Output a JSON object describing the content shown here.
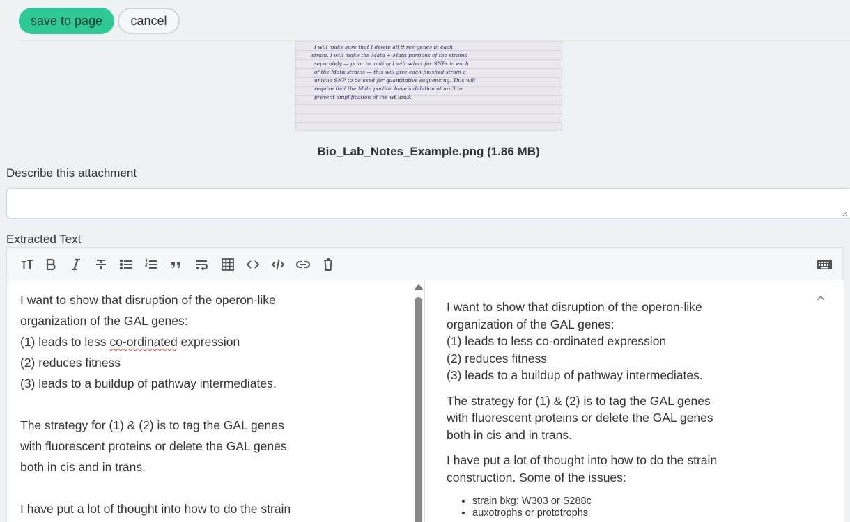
{
  "actions": {
    "save_label": "save to page",
    "cancel_label": "cancel"
  },
  "attachment": {
    "filename": "Bio_Lab_Notes_Example.png (1.86 MB)",
    "preview_handwriting": [
      "I will make sure that I delete all three genes in each",
      "strain. I will make the Mata + Matα portions of the strains",
      "separately — prior to mating I will select for SNPs in each",
      "of the Matα strains — this will give each finished strain a",
      "unique SNP to be used for quantitative sequencing. This will",
      "require that the Mata portion have a deletion of ura3 to",
      "prevent amplification of the wt ura3."
    ]
  },
  "describe": {
    "label": "Describe this attachment",
    "value": ""
  },
  "extracted": {
    "label": "Extracted Text",
    "toolbar": [
      "heading-icon",
      "bold-icon",
      "italic-icon",
      "strikethrough-icon",
      "bullet-list-icon",
      "numbered-list-icon",
      "quote-icon",
      "wrap-icon",
      "table-icon",
      "code-icon",
      "code-block-icon",
      "link-icon",
      "trash-icon",
      "keyboard-icon"
    ],
    "source": {
      "line1": "I want to show that disruption of the operon-like",
      "line2": "organization of the GAL genes:",
      "line3_pre": "(1) leads to less ",
      "line3_spell": "co-ordinated",
      "line3_post": " expression",
      "line4": "(2) reduces fitness",
      "line5": "(3) leads to a buildup of pathway intermediates.",
      "line7": "The strategy for (1) & (2) is to tag the GAL genes",
      "line8": "with fluorescent proteins or delete the GAL genes",
      "line9": "both in cis and in trans.",
      "line11": "I have put a lot of thought into how to do the strain"
    },
    "preview": {
      "p1_l1": "I want to show that disruption of the operon-like",
      "p1_l2": "organization of the GAL genes:",
      "p1_l3": "(1) leads to less co-ordinated expression",
      "p1_l4": "(2) reduces fitness",
      "p1_l5": "(3) leads to a buildup of pathway intermediates.",
      "p2_l1": "The strategy for (1) & (2) is to tag the GAL genes",
      "p2_l2": "with fluorescent proteins or delete the GAL genes",
      "p2_l3": "both in cis and in trans.",
      "p3_l1": "I have put a lot of thought into how to do the strain",
      "p3_l2": "construction. Some of the issues:",
      "bullets": [
        "strain bkg: W303 or S288c",
        "auxotrophs or prototrophs"
      ]
    }
  }
}
